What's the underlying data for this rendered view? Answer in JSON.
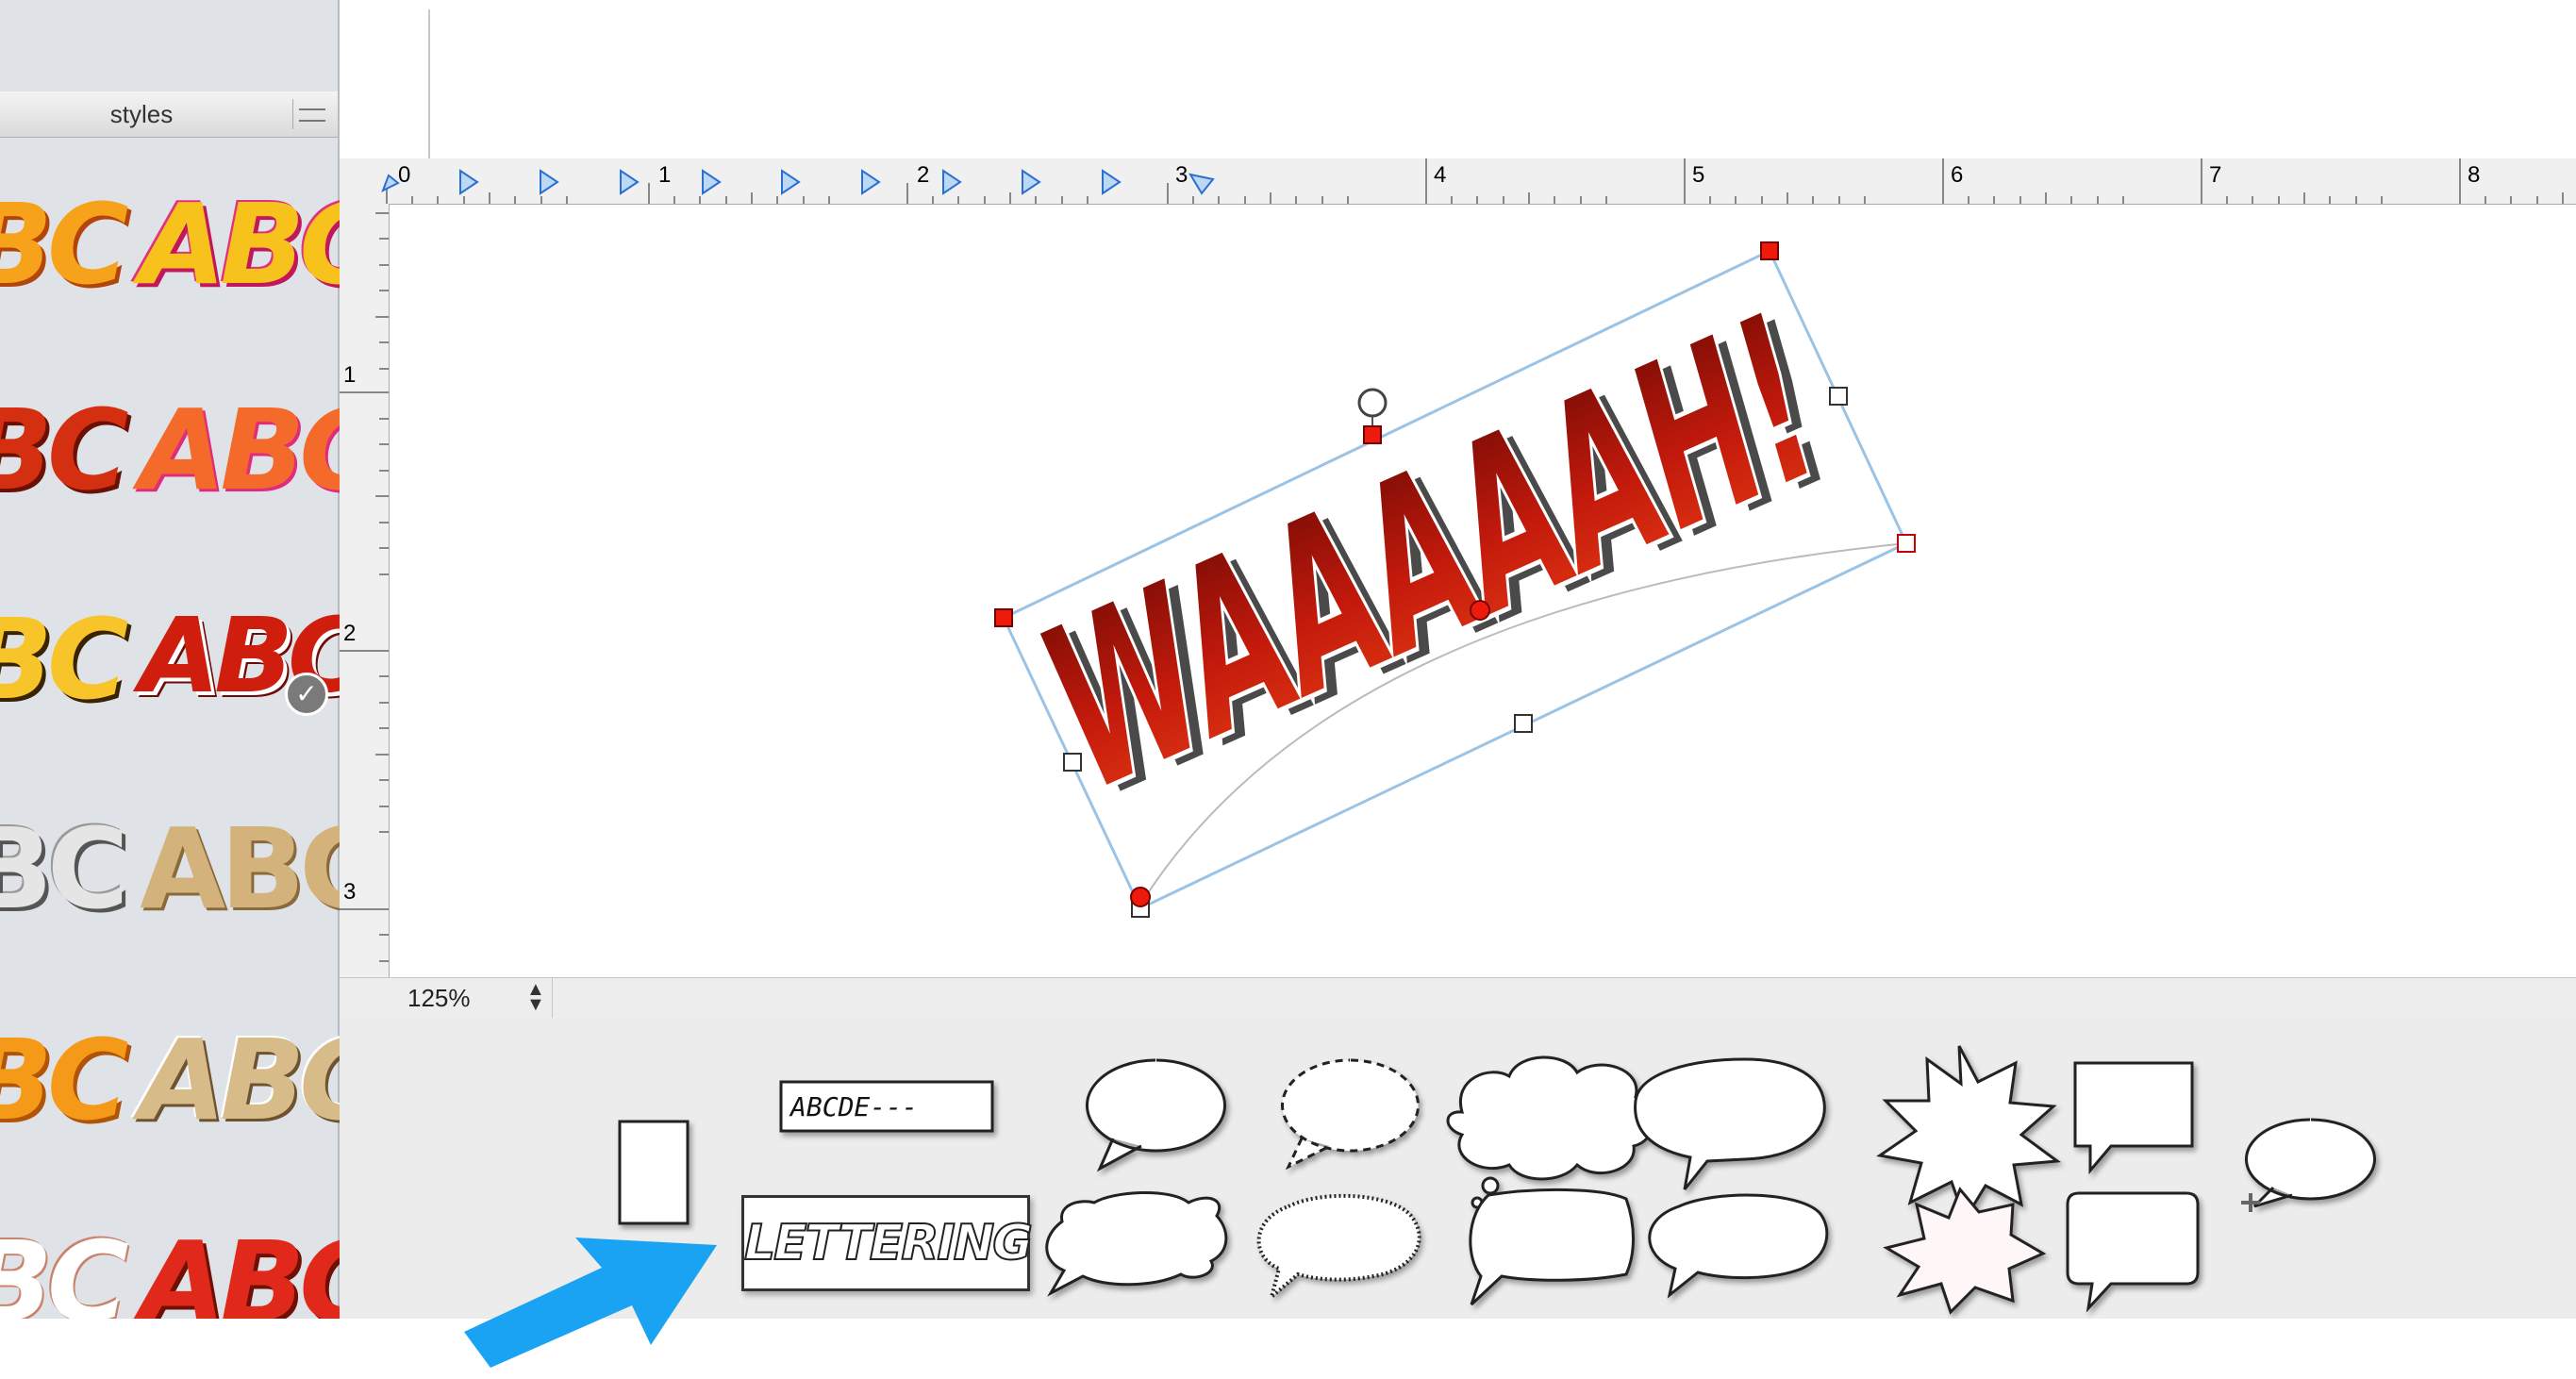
{
  "styles_panel": {
    "title": "styles",
    "swatches": [
      {
        "text": "BC",
        "row": 1,
        "col": 1
      },
      {
        "text": "ABC",
        "row": 1,
        "col": 2
      },
      {
        "text": "BC",
        "row": 2,
        "col": 1
      },
      {
        "text": "ABC",
        "row": 2,
        "col": 2
      },
      {
        "text": "BC",
        "row": 3,
        "col": 1
      },
      {
        "text": "ABC",
        "row": 3,
        "col": 2
      },
      {
        "text": "BC",
        "row": 4,
        "col": 1
      },
      {
        "text": "ABC",
        "row": 4,
        "col": 2
      },
      {
        "text": "BC",
        "row": 5,
        "col": 1
      },
      {
        "text": "ABC",
        "row": 5,
        "col": 2
      },
      {
        "text": "BC",
        "row": 6,
        "col": 1
      },
      {
        "text": "ABC",
        "row": 6,
        "col": 2
      }
    ]
  },
  "ruler": {
    "horizontal_labels": [
      "0",
      "1",
      "2",
      "3",
      "4",
      "5",
      "6",
      "7",
      "8"
    ],
    "vertical_labels": [
      "1",
      "2",
      "3"
    ]
  },
  "canvas": {
    "lettering_text": "WAAAAAH!"
  },
  "status": {
    "zoom": "125%"
  },
  "palette": {
    "caption_sample": "ABCDE---",
    "lettering_sample": "LETTERING"
  },
  "colors": {
    "accent_blue": "#1aa3f2",
    "lettering_red": "#c41a0c",
    "handle_red": "#ee1b0c",
    "selection_blue": "#9ac3e6"
  }
}
